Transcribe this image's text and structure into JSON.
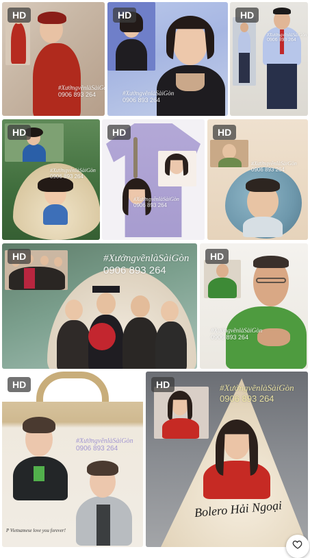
{
  "gallery": {
    "badge_label": "HD",
    "watermark_name": "#XưởngvẽnlàSàiGòn",
    "watermark_phone": "0906 893 264",
    "tiles": [
      {
        "id": "tile-1",
        "subject": "woman in red ao dai portrait painting"
      },
      {
        "id": "tile-2",
        "subject": "woman in black jacket portrait painting"
      },
      {
        "id": "tile-3",
        "subject": "man in shirt and red tie full-body painting"
      },
      {
        "id": "tile-4",
        "subject": "girl drawn on conical hat"
      },
      {
        "id": "tile-5",
        "subject": "woman painted on purple shirt"
      },
      {
        "id": "tile-6",
        "subject": "boy portrait painted on round stone"
      },
      {
        "id": "tile-7",
        "subject": "family graduation painting on conical hat"
      },
      {
        "id": "tile-8",
        "subject": "man in green polo portrait painting"
      },
      {
        "id": "tile-9",
        "subject": "young man painted on tote bag"
      },
      {
        "id": "tile-10",
        "subject": "woman painted on conical hat"
      }
    ]
  },
  "hat_text": "Bolero Hải Ngoại",
  "bag_text": "P Vietnamese love you forever!",
  "colors": {
    "badge_bg": "#3c3c3c",
    "red": "#c62a24",
    "green": "#3d8a36",
    "purple": "#a79ccf"
  },
  "favorite_icon": "heart-outline-icon"
}
